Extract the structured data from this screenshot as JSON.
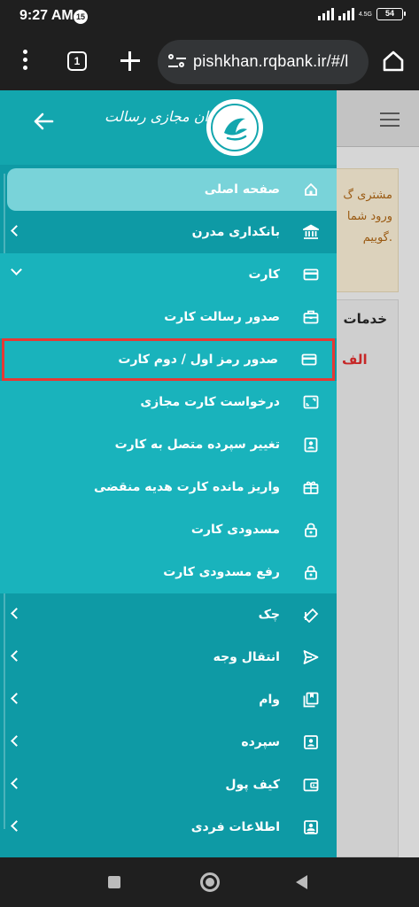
{
  "status_bar": {
    "time": "9:27 AM",
    "notification_badge": "15",
    "network": "4.5G",
    "battery": "54"
  },
  "browser": {
    "tab_count": "1",
    "url": "pishkhan.rqbank.ir/#/l"
  },
  "background_page": {
    "notice_lines": [
      "مشتری گ",
      "ورود شما",
      "گوییم."
    ],
    "card_title": "خدمات",
    "red_label": "الف"
  },
  "drawer": {
    "logo_text": "پیشخوان مجازی رسالت",
    "menu": [
      {
        "label": "صفحه اصلی",
        "icon": "home-icon",
        "state": "active"
      },
      {
        "label": "بانکداری مدرن",
        "icon": "bank-icon",
        "state": "collapsed"
      },
      {
        "label": "کارت",
        "icon": "card-icon",
        "state": "expanded"
      },
      {
        "label": "صدور رسالت کارت",
        "icon": "briefcase-icon",
        "state": "child"
      },
      {
        "label": "صدور رمز اول / دوم کارت",
        "icon": "card-icon",
        "state": "highlighted"
      },
      {
        "label": "درخواست کارت مجازی",
        "icon": "virtual-card-icon",
        "state": "child"
      },
      {
        "label": "تغییر سپرده متصل به کارت",
        "icon": "contact-card-icon",
        "state": "child"
      },
      {
        "label": "واریز مانده کارت هدیه منقضی",
        "icon": "gift-icon",
        "state": "child"
      },
      {
        "label": "مسدودی کارت",
        "icon": "lock-icon",
        "state": "child"
      },
      {
        "label": "رفع مسدودی کارت",
        "icon": "lock-icon",
        "state": "child"
      },
      {
        "label": "چک",
        "icon": "cheque-icon",
        "state": "collapsed"
      },
      {
        "label": "انتقال وجه",
        "icon": "send-icon",
        "state": "collapsed"
      },
      {
        "label": "وام",
        "icon": "loan-book-icon",
        "state": "collapsed"
      },
      {
        "label": "سپرده",
        "icon": "deposit-icon",
        "state": "collapsed"
      },
      {
        "label": "کیف پول",
        "icon": "wallet-icon",
        "state": "collapsed"
      },
      {
        "label": "اطلاعات فردی",
        "icon": "profile-icon",
        "state": "collapsed"
      }
    ]
  },
  "colors": {
    "drawer": "#0e9aa5",
    "drawer_header": "#13a6ae",
    "submenu": "#19b3bc",
    "active_item": "#79d3d9",
    "highlight_outline": "#e53935",
    "chrome": "#1f1f1f"
  }
}
